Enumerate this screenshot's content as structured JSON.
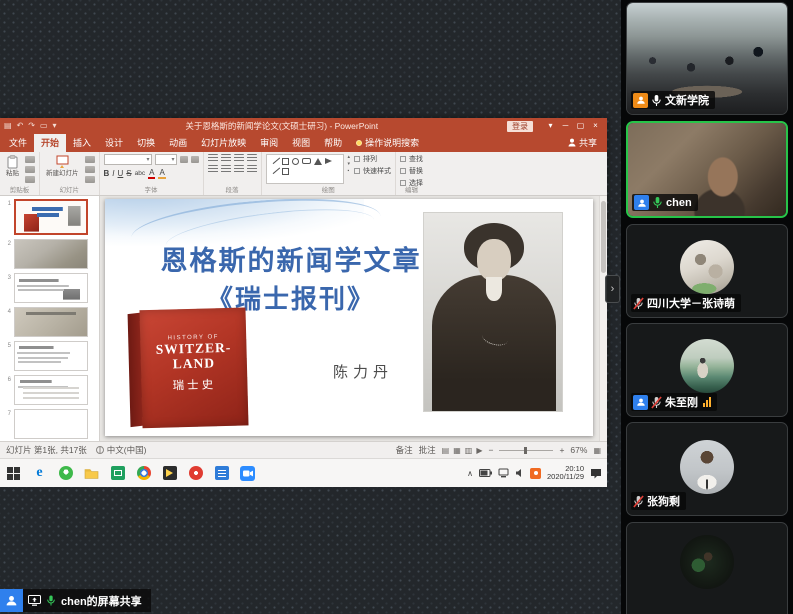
{
  "meeting": {
    "share_banner": "chen的屏幕共享",
    "participants": [
      {
        "name": "文新学院",
        "mic": "on",
        "role_badge": "orange"
      },
      {
        "name": "chen",
        "mic": "speaking",
        "role_badge": "blue",
        "active_speaker": true
      },
      {
        "name": "四川大学－张诗萌",
        "mic": "muted"
      },
      {
        "name": "朱至刚",
        "mic": "muted",
        "role_badge": "blue",
        "network": "poor"
      },
      {
        "name": "张狗剩",
        "mic": "muted"
      },
      {
        "name": "",
        "mic": "none"
      }
    ]
  },
  "ppt": {
    "title": "关于恩格斯的新闻学论文(文硕士研习) - PowerPoint",
    "signin": "登录",
    "share": "共享",
    "tellme": "操作说明搜索",
    "tabs": [
      "文件",
      "开始",
      "插入",
      "设计",
      "切换",
      "动画",
      "幻灯片放映",
      "审阅",
      "视图",
      "帮助"
    ],
    "active_tab": "开始",
    "groups": [
      "剪贴板",
      "幻灯片",
      "字体",
      "段落",
      "绘图",
      "编辑"
    ],
    "ribbon": {
      "paste": "粘贴",
      "new_slide": "新建幻灯片",
      "bold": "B",
      "italic": "I",
      "underline": "U",
      "strike": "S",
      "clear": "abc",
      "font_color": "A",
      "fill_color": "A",
      "arrange": "排列",
      "quick_styles": "快速样式",
      "find": "查找",
      "replace": "替换",
      "select": "选择"
    },
    "thumbs": [
      "1",
      "2",
      "3",
      "4",
      "5",
      "6",
      "7"
    ],
    "slide": {
      "title1": "恩格斯的新闻学文章",
      "title2": "《瑞士报刊》",
      "author": "陈力丹",
      "book1": "HISTORY OF",
      "book2": "SWITZER-",
      "book3": "LAND",
      "book4": "瑞士史"
    },
    "status": {
      "slide_info": "幻灯片 第1张, 共17张",
      "language": "中文(中国)",
      "notes": "备注",
      "comments": "批注",
      "zoom": "67%"
    }
  },
  "taskbar": {
    "time": "20:10",
    "date": "2020/11/29"
  },
  "icons": {
    "save": "▤",
    "undo": "↶",
    "redo": "↷",
    "present": "▭",
    "caret": "▾",
    "minimize": "─",
    "restore": "▢",
    "close": "×",
    "collapse": "›",
    "tray_caret": "∧",
    "gal_up": "▴",
    "gal_down": "▾",
    "gal_more": "▪",
    "zoom_minus": "−",
    "zoom_plus": "+",
    "edge_letter": "e",
    "view_normal": "▤",
    "view_sorter": "▦",
    "view_read": "▥",
    "view_show": "▶"
  }
}
